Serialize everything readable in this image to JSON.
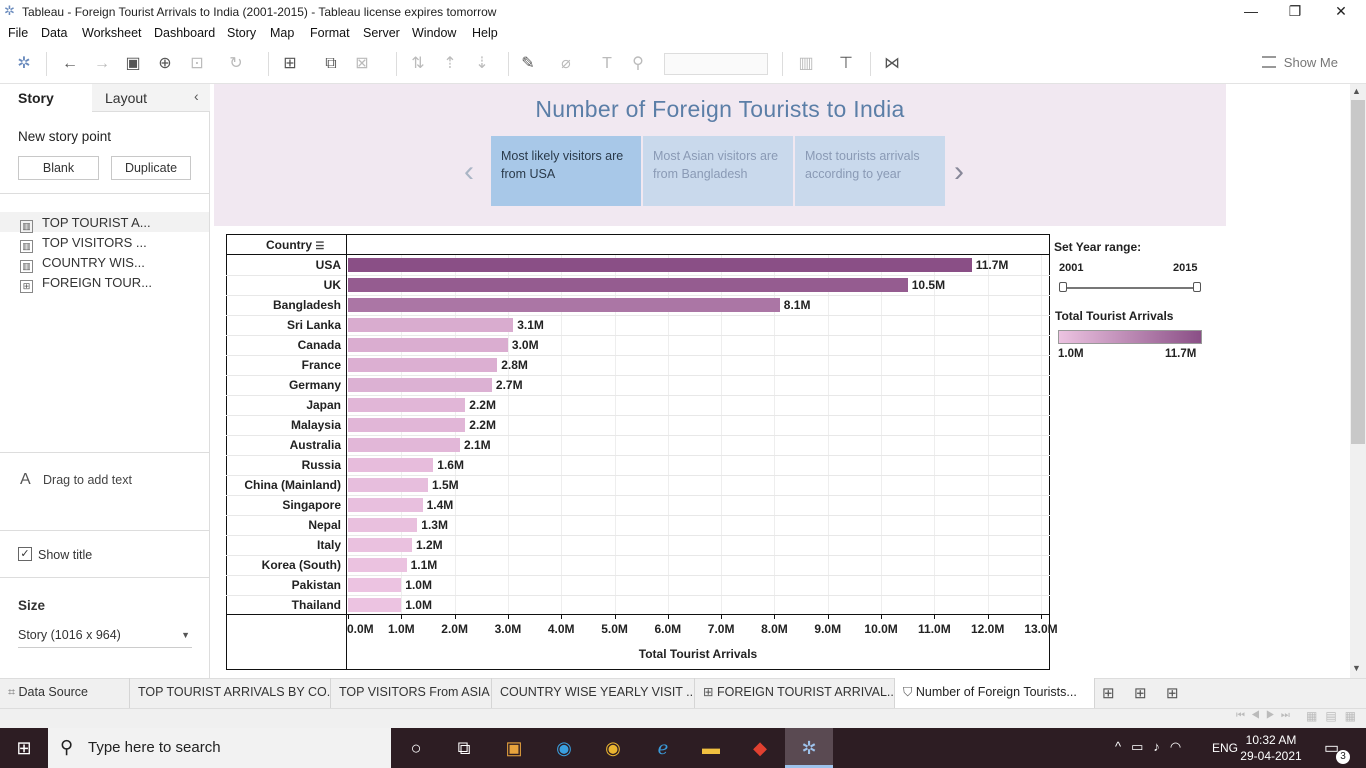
{
  "window": {
    "title": "Tableau - Foreign Tourist Arrivals to India (2001-2015) - Tableau license expires tomorrow",
    "minimize": "—",
    "restore": "❐",
    "close": "✕"
  },
  "menu": [
    "File",
    "Data",
    "Worksheet",
    "Dashboard",
    "Story",
    "Map",
    "Format",
    "Server",
    "Window",
    "Help"
  ],
  "toolbar": {
    "show_me": "Show Me"
  },
  "left_pane": {
    "tabs": {
      "story": "Story",
      "layout": "Layout"
    },
    "new_story_point": "New story point",
    "blank_btn": "Blank",
    "duplicate_btn": "Duplicate",
    "sheets": [
      "TOP TOURIST A...",
      "TOP VISITORS ...",
      "COUNTRY WIS...",
      "FOREIGN TOUR..."
    ],
    "drag_text": "Drag to add text",
    "show_title": "Show title",
    "size_label": "Size",
    "size_value": "Story (1016 x 964)"
  },
  "story": {
    "title": "Number of Foreign Tourists to India",
    "points": [
      "Most likely visitors are from USA",
      "Most Asian visitors are from Bangladesh",
      "Most tourists arrivals according to year"
    ]
  },
  "chart_data": {
    "type": "bar",
    "orientation": "horizontal",
    "row_header": "Country",
    "xlabel": "Total Tourist Arrivals",
    "categories": [
      "USA",
      "UK",
      "Bangladesh",
      "Sri Lanka",
      "Canada",
      "France",
      "Germany",
      "Japan",
      "Malaysia",
      "Australia",
      "Russia",
      "China (Mainland)",
      "Singapore",
      "Nepal",
      "Italy",
      "Korea (South)",
      "Pakistan",
      "Thailand"
    ],
    "values": [
      11.7,
      10.5,
      8.1,
      3.1,
      3.0,
      2.8,
      2.7,
      2.2,
      2.2,
      2.1,
      1.6,
      1.5,
      1.4,
      1.3,
      1.2,
      1.1,
      1.0,
      1.0
    ],
    "value_labels": [
      "11.7M",
      "10.5M",
      "8.1M",
      "3.1M",
      "3.0M",
      "2.8M",
      "2.7M",
      "2.2M",
      "2.2M",
      "2.1M",
      "1.6M",
      "1.5M",
      "1.4M",
      "1.3M",
      "1.2M",
      "1.1M",
      "1.0M",
      "1.0M"
    ],
    "unit": "M",
    "xlim": [
      0,
      13.0
    ],
    "ticks": [
      "0.0M",
      "1.0M",
      "2.0M",
      "3.0M",
      "4.0M",
      "5.0M",
      "6.0M",
      "7.0M",
      "8.0M",
      "9.0M",
      "10.0M",
      "11.0M",
      "12.0M",
      "13.0M"
    ],
    "color_low": "#ecc3e1",
    "color_high": "#8a4f86",
    "grid": true
  },
  "filters": {
    "year_range_title": "Set Year range:",
    "year_from": "2001",
    "year_to": "2015",
    "legend_title": "Total Tourist Arrivals",
    "legend_min": "1.0M",
    "legend_max": "11.7M"
  },
  "sheet_tabs": [
    "Data Source",
    "TOP TOURIST ARRIVALS BY CO...",
    "TOP VISITORS From ASIA",
    "COUNTRY WISE YEARLY VISIT ...",
    "FOREIGN TOURIST ARRIVAL...",
    "Number of Foreign Tourists..."
  ],
  "taskbar": {
    "search_placeholder": "Type here to search",
    "lang": "ENG",
    "time": "10:32 AM",
    "date": "29-04-2021",
    "notif_count": "3"
  }
}
